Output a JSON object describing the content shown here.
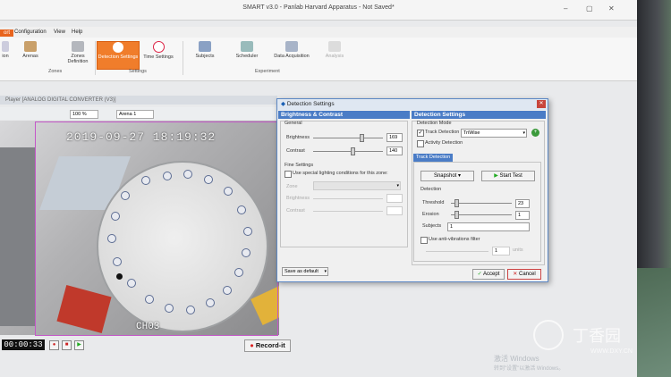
{
  "window": {
    "title": "SMART v3.0 - Panlab Harvard Apparatus - Not Saved*"
  },
  "menu": {
    "items": [
      "ort",
      "Configuration",
      "View",
      "Help"
    ]
  },
  "ribbon": {
    "buttons": [
      {
        "label": "ion"
      },
      {
        "label": "Arenas"
      },
      {
        "label": "Zones Definition"
      },
      {
        "label": "Detection Settings"
      },
      {
        "label": "Time Settings"
      },
      {
        "label": "Subjects"
      },
      {
        "label": "Scheduler"
      },
      {
        "label": "Data Acquisition"
      },
      {
        "label": "Analysis"
      }
    ],
    "groups": [
      "Zones",
      "Settings",
      "Experiment"
    ]
  },
  "player": {
    "title": "Player [ANALOG DIGITAL CONVERTER (V3)]",
    "zoom": "100 %",
    "arena": "Arena 1",
    "timestamp": "2019-09-27 18:19:32",
    "channel": "CH03",
    "timer": "00:00:33",
    "record_label": "Record-it"
  },
  "dialog": {
    "title": "Detection Settings",
    "left": {
      "header": "Brightness & Contrast",
      "general_label": "General",
      "brightness_label": "Brightness",
      "brightness_value": "169",
      "contrast_label": "Contrast",
      "contrast_value": "140",
      "fine_label": "Fine Settings",
      "special_label": "Use special lighting conditions for this zone:",
      "zone_label": "Zone",
      "fine_brightness_label": "Brightness",
      "fine_contrast_label": "Contrast",
      "save_default": "Save as default"
    },
    "right": {
      "header": "Detection Settings",
      "mode_label": "Detection Mode",
      "track_label": "Track Detection",
      "track_mode": "TriWise",
      "activity_label": "Activity Detection",
      "tab_label": "Track Detection",
      "snapshot": "Snapshot",
      "start_test": "Start Test",
      "detection_label": "Detection",
      "threshold_label": "Threshold",
      "threshold_value": "23",
      "erosion_label": "Erosion",
      "erosion_value": "1",
      "subjects_label": "Subjects",
      "subjects_value": "1",
      "antivib_label": "Use anti-vibrations filter",
      "antivib_value": "1",
      "antivib_unit": "units",
      "accept": "Accept",
      "cancel": "Cancel"
    }
  },
  "watermark": {
    "activate": "激活 Windows",
    "activate_sub": "转到\"设置\"以激活 Windows。",
    "site_cn": "丁香园",
    "site_url": "WWW.DXY.CN"
  }
}
